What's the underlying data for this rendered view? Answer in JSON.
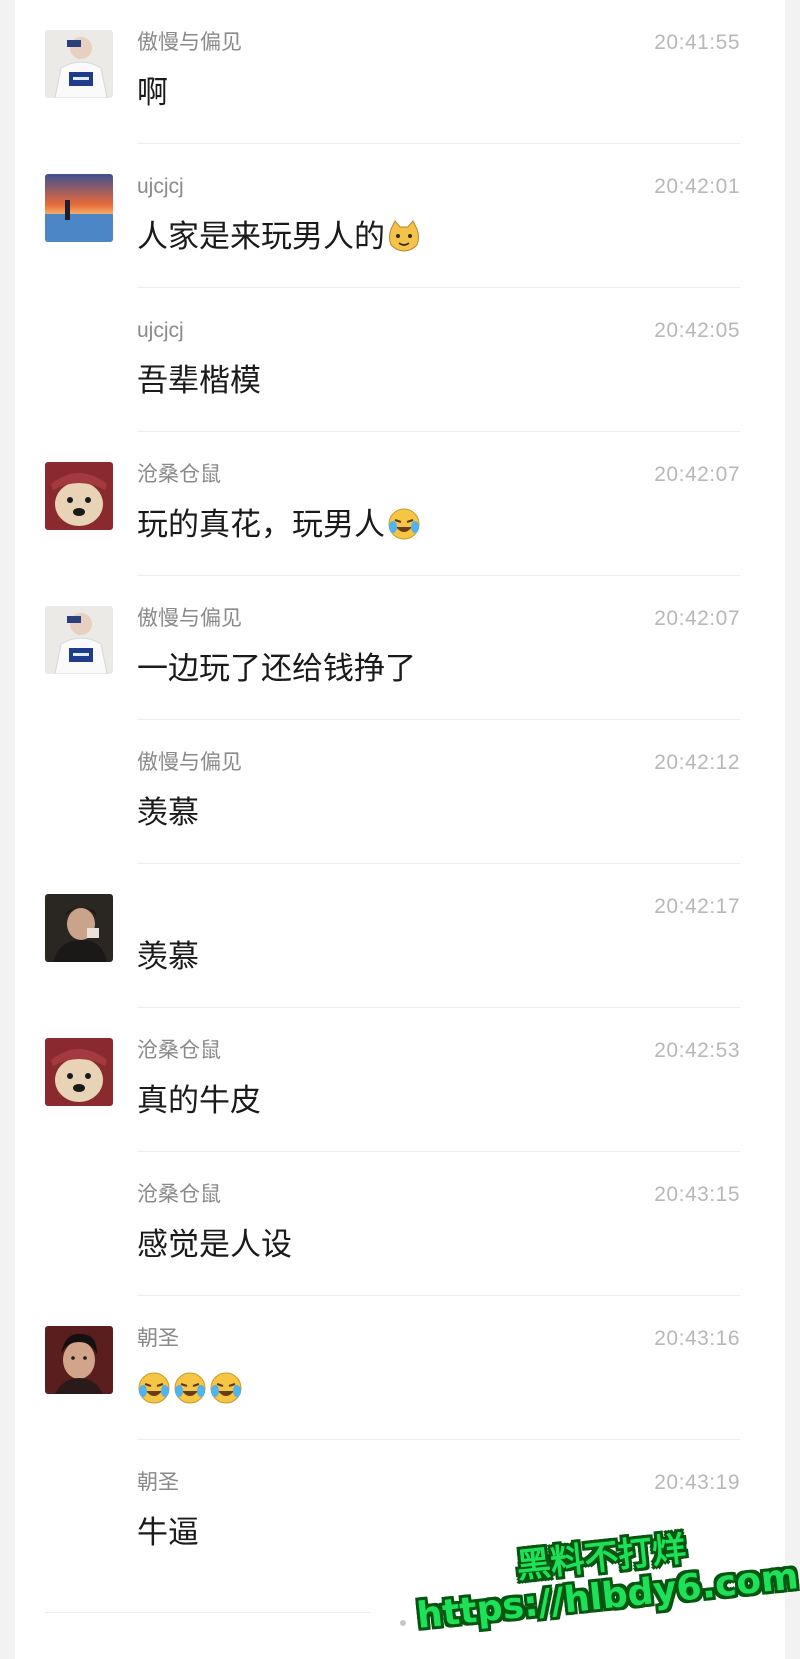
{
  "messages": [
    {
      "name": "傲慢与偏见",
      "time": "20:41:55",
      "text": "啊",
      "avatar": "man-white-shirt-avatar",
      "show_avatar": true
    },
    {
      "name": "ujcjcj",
      "time": "20:42:01",
      "text": "人家是来玩男人的",
      "emoji": [
        "cat-face"
      ],
      "avatar": "sunset-photo-avatar",
      "show_avatar": true
    },
    {
      "name": "ujcjcj",
      "time": "20:42:05",
      "text": "吾辈楷模",
      "show_avatar": false
    },
    {
      "name": "沧桑仓鼠",
      "time": "20:42:07",
      "text": "玩的真花，玩男人",
      "emoji": [
        "laugh-cry"
      ],
      "avatar": "dog-hat-avatar",
      "show_avatar": true
    },
    {
      "name": "傲慢与偏见",
      "time": "20:42:07",
      "text": "一边玩了还给钱挣了",
      "avatar": "man-white-shirt-avatar",
      "show_avatar": true
    },
    {
      "name": "傲慢与偏见",
      "time": "20:42:12",
      "text": "羡慕",
      "show_avatar": false
    },
    {
      "name": "",
      "time": "20:42:17",
      "text": "羡慕",
      "avatar": "dark-portrait-avatar",
      "show_avatar": true
    },
    {
      "name": "沧桑仓鼠",
      "time": "20:42:53",
      "text": "真的牛皮",
      "avatar": "dog-hat-avatar",
      "show_avatar": true
    },
    {
      "name": "沧桑仓鼠",
      "time": "20:43:15",
      "text": "感觉是人设",
      "show_avatar": false
    },
    {
      "name": "朝圣",
      "time": "20:43:16",
      "text": "",
      "emoji": [
        "laugh-cry",
        "laugh-cry",
        "laugh-cry"
      ],
      "avatar": "man-portrait-avatar",
      "show_avatar": true
    },
    {
      "name": "朝圣",
      "time": "20:43:19",
      "text": "牛逼",
      "show_avatar": false
    }
  ],
  "watermark": {
    "line1": "黑料不打烊",
    "line2": "https://hlbdy6.com"
  }
}
